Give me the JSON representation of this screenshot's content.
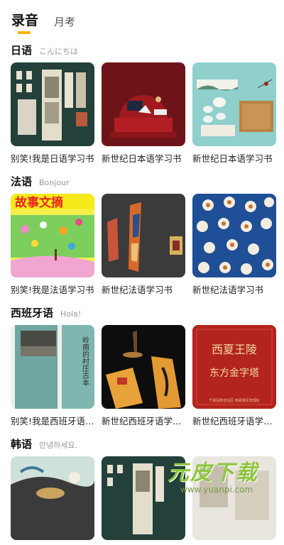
{
  "tabs": [
    {
      "label": "录音",
      "active": true
    },
    {
      "label": "月考",
      "active": false
    }
  ],
  "sections": [
    {
      "title": "日语",
      "subtitle": "こんにちは",
      "items": [
        "别笑!我是日语学习书",
        "新世纪日本语学习书",
        "新世纪日本语学习书"
      ]
    },
    {
      "title": "法语",
      "subtitle": "Bonjour",
      "items": [
        "别笑!我是法语学习书",
        "新世纪法语学习书",
        "新世纪法语学习书"
      ]
    },
    {
      "title": "西班牙语",
      "subtitle": "Hola!",
      "items": [
        "别笑!我是西班牙语学习书",
        "新世纪西班牙语学习书",
        "新世纪西班牙语学习书"
      ]
    },
    {
      "title": "韩语",
      "subtitle": "안녕하세요.",
      "items": [
        "",
        "",
        ""
      ]
    }
  ],
  "covers": {
    "magazine_title": "故事文摘",
    "lingnan_text": "岭南的村庄古本",
    "xixia_title": "西夏王陵",
    "xixia_subtitle": "东方金字塔",
    "xixia_footer": "宁夏回族自治区 西夏陵区管理处"
  },
  "watermark": {
    "main": "元皮下载",
    "url": "www.yuanpi.com"
  },
  "colors": {
    "accent": "#f5b400",
    "watermark": "#8ec63f"
  }
}
